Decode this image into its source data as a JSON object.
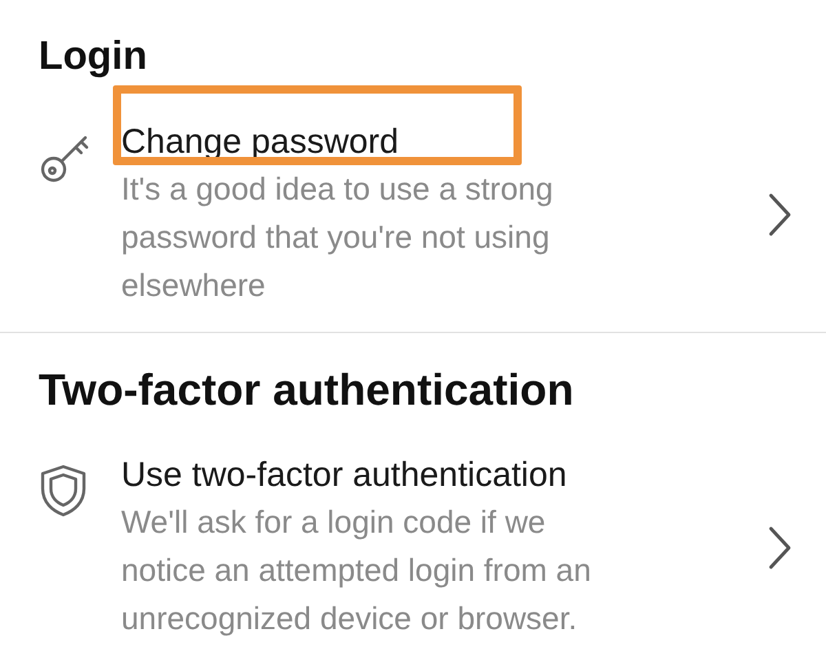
{
  "sections": [
    {
      "title": "Login",
      "items": [
        {
          "kind": "key",
          "title": "Change password",
          "description": "It's a good idea to use a strong password that you're not using elsewhere",
          "highlighted": true
        }
      ]
    },
    {
      "title": "Two-factor authentication",
      "items": [
        {
          "kind": "shield",
          "title": "Use two-factor authentication",
          "description": "We'll ask for a login code if we notice an attempted login from an unrecognized device or browser.",
          "highlighted": false
        }
      ]
    }
  ]
}
